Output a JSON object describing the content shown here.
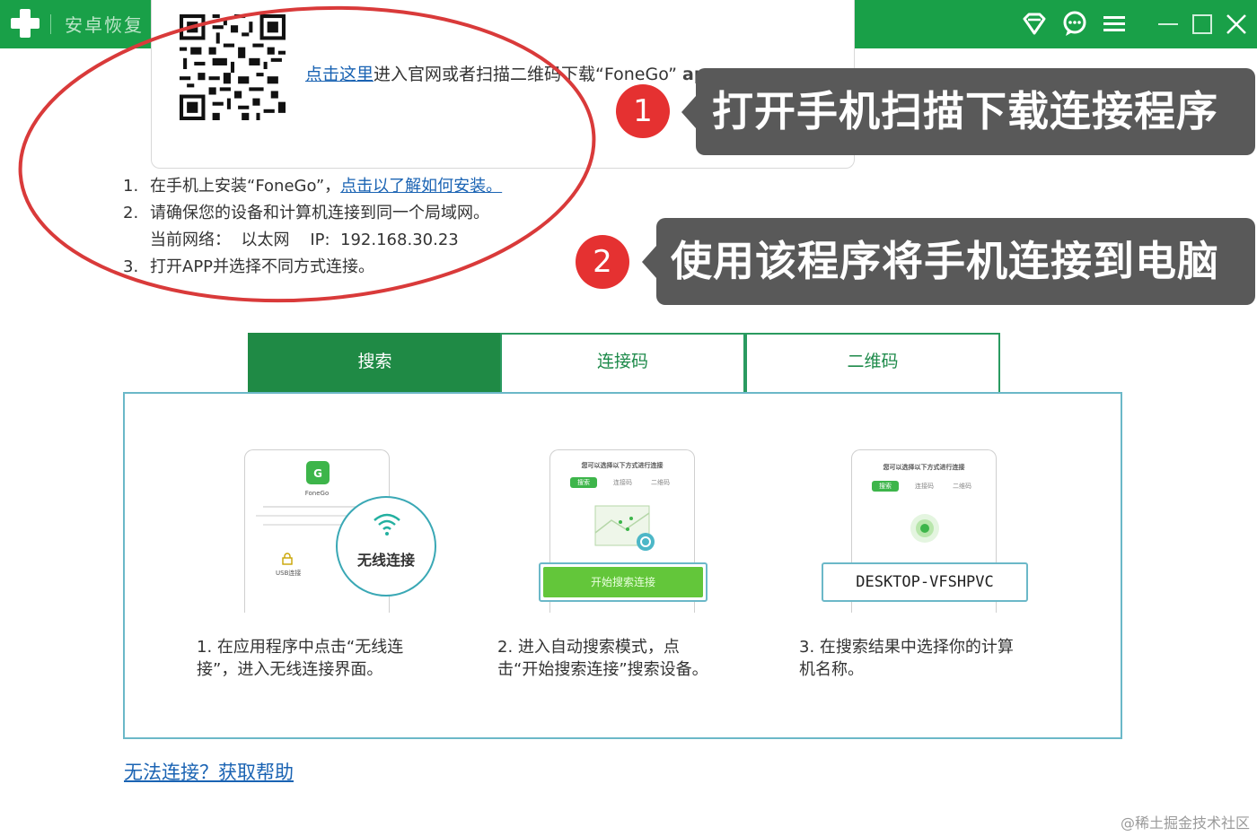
{
  "app": {
    "title": "安卓恢复",
    "logo_icon": "green-plus-icon",
    "accent_color": "#19a048"
  },
  "titlebar": {
    "icons": [
      "diamond-icon",
      "chat-icon",
      "menu-icon",
      "minimize-icon",
      "maximize-icon",
      "close-icon"
    ]
  },
  "panel": {
    "download_link": "点击这里",
    "download_text": "进入官网或者扫描二维码下载“FoneGo”",
    "download_tail": "app."
  },
  "steps": {
    "step1_num": "1.",
    "step1_text": "在手机上安装“FoneGo”，",
    "step1_link": "点击以了解如何安装。",
    "step2_num": "2.",
    "step2_text": "请确保您的设备和计算机连接到同一个局域网。",
    "network_label": "当前网络：",
    "network_value": "以太网",
    "ip_label": "IP:",
    "ip_value": "192.168.30.23",
    "step3_num": "3.",
    "step3_text": "打开APP并选择不同方式连接。"
  },
  "annotations": {
    "badge1": "1",
    "callout1": "打开手机扫描下载连接程序",
    "badge2": "2",
    "callout2": "使用该程序将手机连接到电脑",
    "ellipse_color": "#d93a3a"
  },
  "tabs": [
    {
      "label": "搜索",
      "active": true
    },
    {
      "label": "连接码",
      "active": false
    },
    {
      "label": "二维码",
      "active": false
    }
  ],
  "cards": {
    "card1": {
      "app_name": "FoneGo",
      "usb_label": "USB连接",
      "wireless_label": "无线连接",
      "desc_line1": "1.  在应用程序中点击“无线连",
      "desc_line2": "接”，进入无线连接界面。"
    },
    "card2": {
      "header": "您可以选择以下方式进行连接",
      "tab1": "搜索",
      "tab2": "连接码",
      "tab3": "二维码",
      "button": "开始搜索连接",
      "desc_line1": "2.  进入自动搜索模式，点",
      "desc_line2": "击“开始搜索连接”搜索设备。"
    },
    "card3": {
      "header": "您可以选择以下方式进行连接",
      "tab1": "搜索",
      "tab2": "连接码",
      "tab3": "二维码",
      "device": "DESKTOP-VFSHPVC",
      "desc_line1": "3.  在搜索结果中选择你的计算",
      "desc_line2": "机名称。"
    }
  },
  "help_link": "无法连接？获取帮助",
  "watermark": "@稀土掘金技术社区"
}
